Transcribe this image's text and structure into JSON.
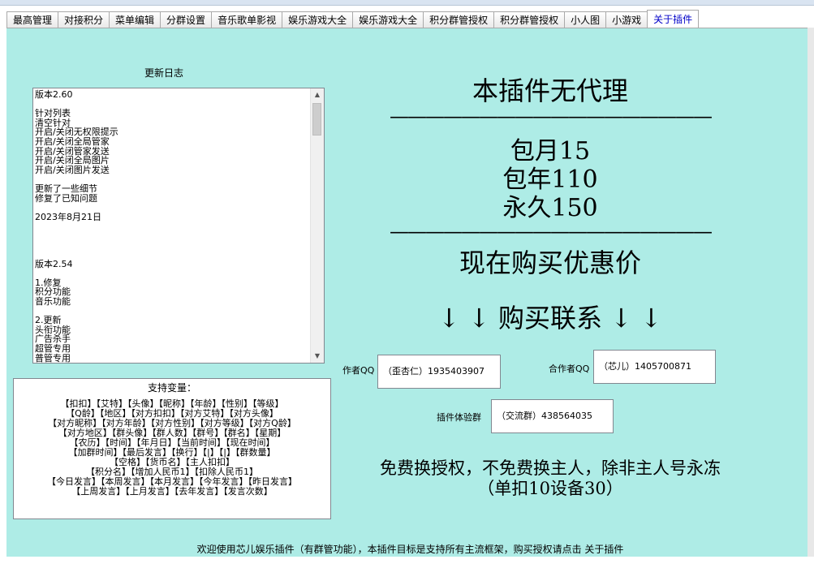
{
  "tabs": [
    {
      "label": "最高管理"
    },
    {
      "label": "对接积分"
    },
    {
      "label": "菜单编辑"
    },
    {
      "label": "分群设置"
    },
    {
      "label": "音乐歌单影视"
    },
    {
      "label": "娱乐游戏大全"
    },
    {
      "label": "娱乐游戏大全"
    },
    {
      "label": "积分群管授权"
    },
    {
      "label": "积分群管授权"
    },
    {
      "label": "小人图"
    },
    {
      "label": "小游戏"
    },
    {
      "label": "关于插件"
    }
  ],
  "changelog": {
    "title": "更新日志",
    "text": "版本2.60\n\n针对列表\n清空针对\n开启/关闭无权限提示\n开启/关闭全局管家\n开启/关闭管家发送\n开启/关闭全局图片\n开启/关闭图片发送\n\n更新了一些细节\n修复了已知问题\n\n2023年8月21日\n\n\n\n\n版本2.54\n\n1.修复\n积分功能\n音乐功能\n\n2.更新\n头衔功能\n广告杀手\n超管专用\n普管专用"
  },
  "variables": {
    "title": "支持变量：",
    "text": "【扣扣】【艾特】【头像】【昵称】【年龄】【性别】【等级】\n【Q龄】【地区】【对方扣扣】【对方艾特】【对方头像】\n【对方昵称】【对方年龄】【对方性别】【对方等级】【对方Q龄】\n【对方地区】【群头像】【群人数】【群号】【群名】【星期】\n【农历】【时间】【年月日】【当前时间】【现在时间】\n【加群时间】【最后发言】【换行】【|】【|】【群数量】\n【空格】【货币名】【主人扣扣】\n【积分名】【增加人民币1】【扣除人民币1】\n【今日发言】【本周发言】【本月发言】【今年发言】【昨日发言】\n【上周发言】【上月发言】【去年发言】【发言次数】"
  },
  "promo": {
    "no_agent": "本插件无代理",
    "divider": "——————————————————",
    "monthly": "包月15",
    "yearly": "包年110",
    "forever": "永久150",
    "discount": "现在购买优惠价",
    "contact": "↓ ↓ 购买联系 ↓ ↓",
    "policy_line1": "免费换授权，不免费换主人，除非主人号永冻",
    "policy_line2": "（单扣10设备30）"
  },
  "contacts": {
    "author_label": "作者QQ",
    "author_value": "（歪杏仁）1935403907",
    "partner_label": "合作者QQ",
    "partner_value": "（芯儿）1405700871",
    "group_label": "插件体验群",
    "group_value": "（交流群）438564035"
  },
  "footer": {
    "text": "欢迎使用芯儿娱乐插件（有群管功能），本插件目标是支持所有主流框架，购买授权请点击 关于插件"
  }
}
